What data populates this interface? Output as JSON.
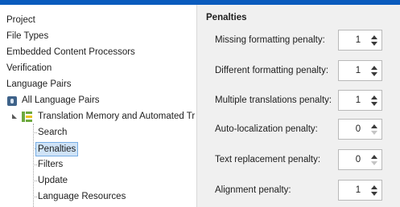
{
  "tree": {
    "items": [
      {
        "label": "Project"
      },
      {
        "label": "File Types"
      },
      {
        "label": "Embedded Content Processors"
      },
      {
        "label": "Verification"
      },
      {
        "label": "Language Pairs"
      },
      {
        "label": "All Language Pairs"
      },
      {
        "label": "Translation Memory and Automated Tr"
      },
      {
        "label": "Search"
      },
      {
        "label": "Penalties"
      },
      {
        "label": "Filters"
      },
      {
        "label": "Update"
      },
      {
        "label": "Language Resources"
      }
    ],
    "selected": "Penalties"
  },
  "panel": {
    "title": "Penalties",
    "fields": [
      {
        "label": "Missing formatting penalty:",
        "value": "1"
      },
      {
        "label": "Different formatting penalty:",
        "value": "1"
      },
      {
        "label": "Multiple translations penalty:",
        "value": "1"
      },
      {
        "label": "Auto-localization penalty:",
        "value": "0"
      },
      {
        "label": "Text replacement penalty:",
        "value": "0"
      },
      {
        "label": "Alignment penalty:",
        "value": "1"
      }
    ]
  },
  "icons": {
    "language-pairs": "globe-icon",
    "translation-memory": "translation-memory-icon",
    "expander": "expanded-triangle-icon"
  },
  "colors": {
    "accent": "#0a5bbd",
    "selection_bg": "#cfe3f7",
    "selection_border": "#78aee5",
    "panel_bg": "#f0f0f0"
  }
}
